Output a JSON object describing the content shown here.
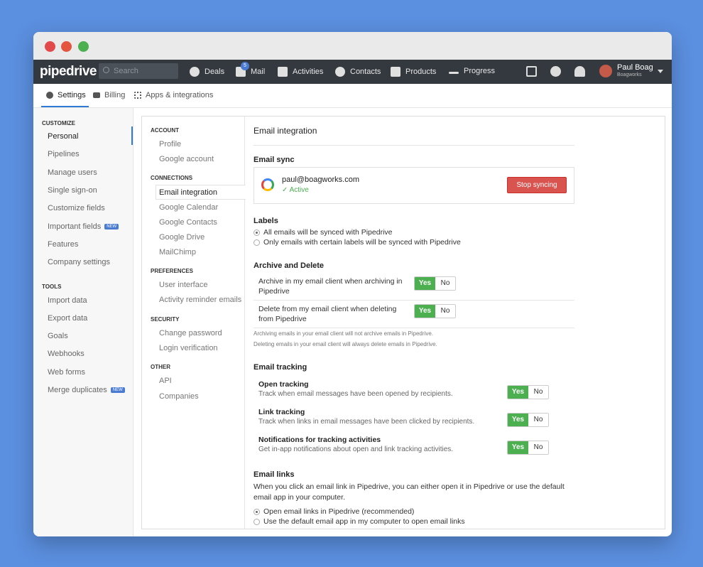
{
  "nav": {
    "logo": "pipedrive",
    "search_placeholder": "Search",
    "items": [
      {
        "label": "Deals",
        "icon": "dollar-icon"
      },
      {
        "label": "Mail",
        "icon": "mail-icon"
      },
      {
        "label": "Activities",
        "icon": "calendar-icon"
      },
      {
        "label": "Contacts",
        "icon": "person-icon"
      },
      {
        "label": "Products",
        "icon": "box-icon"
      },
      {
        "label": "Progress",
        "icon": "chart-icon"
      }
    ],
    "mail_badge": "5",
    "user_name": "Paul Boag",
    "user_org": "Boagworks"
  },
  "subnav": {
    "settings": "Settings",
    "billing": "Billing",
    "apps": "Apps & integrations"
  },
  "left": {
    "customize_head": "CUSTOMIZE",
    "customize": [
      "Personal",
      "Pipelines",
      "Manage users",
      "Single sign-on",
      "Customize fields",
      "Important fields",
      "Features",
      "Company settings"
    ],
    "tools_head": "TOOLS",
    "tools": [
      "Import data",
      "Export data",
      "Goals",
      "Webhooks",
      "Web forms",
      "Merge duplicates"
    ],
    "new_badge": "NEW"
  },
  "settings_nav": {
    "account_head": "ACCOUNT",
    "account": [
      "Profile",
      "Google account"
    ],
    "connections_head": "CONNECTIONS",
    "connections": [
      "Email integration",
      "Google Calendar",
      "Google Contacts",
      "Google Drive",
      "MailChimp"
    ],
    "preferences_head": "PREFERENCES",
    "preferences": [
      "User interface",
      "Activity reminder emails"
    ],
    "security_head": "SECURITY",
    "security": [
      "Change password",
      "Login verification"
    ],
    "other_head": "OTHER",
    "other": [
      "API",
      "Companies"
    ]
  },
  "main": {
    "title": "Email integration",
    "sync_head": "Email sync",
    "sync_email": "paul@boagworks.com",
    "sync_status": "Active",
    "stop_label": "Stop syncing",
    "labels_head": "Labels",
    "labels_opt1": "All emails will be synced with Pipedrive",
    "labels_opt2": "Only emails with certain labels will be synced with Pipedrive",
    "archive_head": "Archive and Delete",
    "archive_label": "Archive in my email client when archiving in Pipedrive",
    "delete_label": "Delete from my email client when deleting from Pipedrive",
    "yes": "Yes",
    "no": "No",
    "note1": "Archiving emails in your email client will not archive emails in Pipedrive.",
    "note2": "Deleting emails in your email client will always delete emails in Pipedrive.",
    "tracking_head": "Email tracking",
    "open_title": "Open tracking",
    "open_desc": "Track when email messages have been opened by recipients.",
    "link_title": "Link tracking",
    "link_desc": "Track when links in email messages have been clicked by recipients.",
    "notif_title": "Notifications for tracking activities",
    "notif_desc": "Get in-app notifications about open and link tracking activities.",
    "links_head": "Email links",
    "links_para": "When you click an email link in Pipedrive, you can either open it in Pipedrive or use the default email app in your computer.",
    "links_opt1": "Open email links in Pipedrive (recommended)",
    "links_opt2": "Use the default email app in my computer to open email links"
  }
}
